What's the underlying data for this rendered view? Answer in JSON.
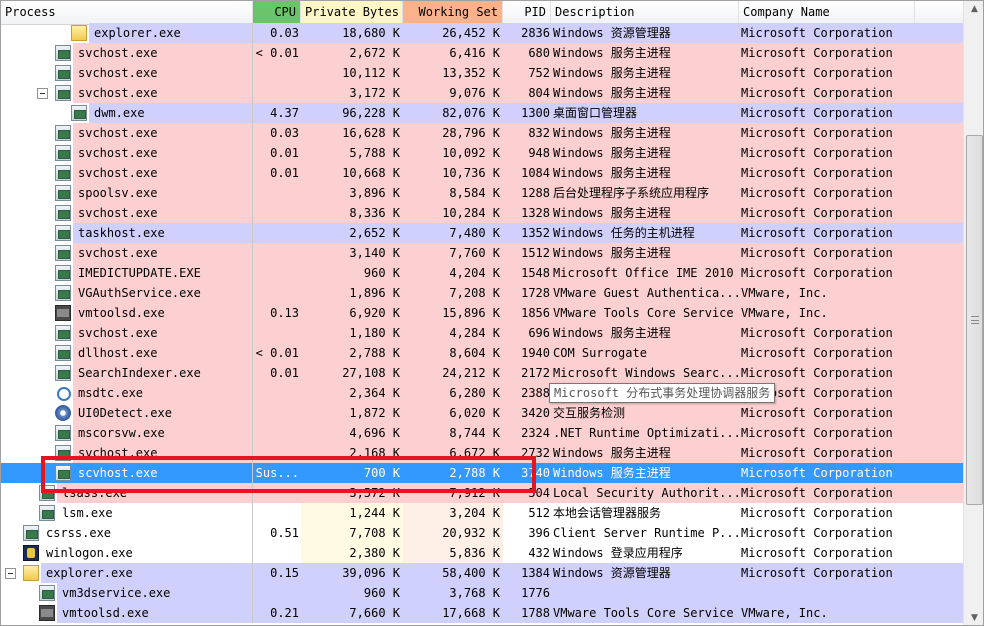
{
  "columns": {
    "process": "Process",
    "cpu": "CPU",
    "private_bytes": "Private Bytes",
    "working_set": "Working Set",
    "pid": "PID",
    "description": "Description",
    "company": "Company Name"
  },
  "colors": {
    "service_row": "#fcd0d0",
    "user_row": "#d0d0fc",
    "selected_row": "#3399ff",
    "cpu_header": "#6ac46a",
    "private_header": "#fdf6c6",
    "working_header": "#fbb189",
    "annotation": "#e8131c"
  },
  "tooltip": "Microsoft 分布式事务处理协调器服务",
  "processes": [
    {
      "name": "explorer.exe",
      "cpu": "0.03",
      "priv": "18,680 K",
      "ws": "26,452 K",
      "pid": "2836",
      "desc": "Windows 资源管理器",
      "comp": "Microsoft Corporation",
      "icon": "folder-icon",
      "kind": "usr",
      "indent": 3
    },
    {
      "name": "svchost.exe",
      "cpu": "< 0.01",
      "priv": "2,672 K",
      "ws": "6,416 K",
      "pid": "680",
      "desc": "Windows 服务主进程",
      "comp": "Microsoft Corporation",
      "icon": "service-icon",
      "kind": "svc",
      "indent": 2
    },
    {
      "name": "svchost.exe",
      "cpu": "",
      "priv": "10,112 K",
      "ws": "13,352 K",
      "pid": "752",
      "desc": "Windows 服务主进程",
      "comp": "Microsoft Corporation",
      "icon": "service-icon",
      "kind": "svc",
      "indent": 2
    },
    {
      "name": "svchost.exe",
      "cpu": "",
      "priv": "3,172 K",
      "ws": "9,076 K",
      "pid": "804",
      "desc": "Windows 服务主进程",
      "comp": "Microsoft Corporation",
      "icon": "service-icon",
      "kind": "svc",
      "indent": 2,
      "twisty": true
    },
    {
      "name": "dwm.exe",
      "cpu": "4.37",
      "priv": "96,228 K",
      "ws": "82,076 K",
      "pid": "1300",
      "desc": "桌面窗口管理器",
      "comp": "Microsoft Corporation",
      "icon": "service-icon",
      "kind": "usr",
      "indent": 3
    },
    {
      "name": "svchost.exe",
      "cpu": "0.03",
      "priv": "16,628 K",
      "ws": "28,796 K",
      "pid": "832",
      "desc": "Windows 服务主进程",
      "comp": "Microsoft Corporation",
      "icon": "service-icon",
      "kind": "svc",
      "indent": 2
    },
    {
      "name": "svchost.exe",
      "cpu": "0.01",
      "priv": "5,788 K",
      "ws": "10,092 K",
      "pid": "948",
      "desc": "Windows 服务主进程",
      "comp": "Microsoft Corporation",
      "icon": "service-icon",
      "kind": "svc",
      "indent": 2
    },
    {
      "name": "svchost.exe",
      "cpu": "0.01",
      "priv": "10,668 K",
      "ws": "10,736 K",
      "pid": "1084",
      "desc": "Windows 服务主进程",
      "comp": "Microsoft Corporation",
      "icon": "service-icon",
      "kind": "svc",
      "indent": 2
    },
    {
      "name": "spoolsv.exe",
      "cpu": "",
      "priv": "3,896 K",
      "ws": "8,584 K",
      "pid": "1288",
      "desc": "后台处理程序子系统应用程序",
      "comp": "Microsoft Corporation",
      "icon": "service-icon",
      "kind": "svc",
      "indent": 2
    },
    {
      "name": "svchost.exe",
      "cpu": "",
      "priv": "8,336 K",
      "ws": "10,284 K",
      "pid": "1328",
      "desc": "Windows 服务主进程",
      "comp": "Microsoft Corporation",
      "icon": "service-icon",
      "kind": "svc",
      "indent": 2
    },
    {
      "name": "taskhost.exe",
      "cpu": "",
      "priv": "2,652 K",
      "ws": "7,480 K",
      "pid": "1352",
      "desc": "Windows 任务的主机进程",
      "comp": "Microsoft Corporation",
      "icon": "service-icon",
      "kind": "usr",
      "indent": 2
    },
    {
      "name": "svchost.exe",
      "cpu": "",
      "priv": "3,140 K",
      "ws": "7,760 K",
      "pid": "1512",
      "desc": "Windows 服务主进程",
      "comp": "Microsoft Corporation",
      "icon": "service-icon",
      "kind": "svc",
      "indent": 2
    },
    {
      "name": "IMEDICTUPDATE.EXE",
      "cpu": "",
      "priv": "960 K",
      "ws": "4,204 K",
      "pid": "1548",
      "desc": "Microsoft Office IME 2010",
      "comp": "Microsoft Corporation",
      "icon": "service-icon",
      "kind": "svc",
      "indent": 2
    },
    {
      "name": "VGAuthService.exe",
      "cpu": "",
      "priv": "1,896 K",
      "ws": "7,208 K",
      "pid": "1728",
      "desc": "VMware Guest Authentica...",
      "comp": "VMware, Inc.",
      "icon": "service-icon",
      "kind": "svc",
      "indent": 2
    },
    {
      "name": "vmtoolsd.exe",
      "cpu": "0.13",
      "priv": "6,920 K",
      "ws": "15,896 K",
      "pid": "1856",
      "desc": "VMware Tools Core Service",
      "comp": "VMware, Inc.",
      "icon": "vmware-icon",
      "kind": "svc",
      "indent": 2
    },
    {
      "name": "svchost.exe",
      "cpu": "",
      "priv": "1,180 K",
      "ws": "4,284 K",
      "pid": "696",
      "desc": "Windows 服务主进程",
      "comp": "Microsoft Corporation",
      "icon": "service-icon",
      "kind": "svc",
      "indent": 2
    },
    {
      "name": "dllhost.exe",
      "cpu": "< 0.01",
      "priv": "2,788 K",
      "ws": "8,604 K",
      "pid": "1940",
      "desc": "COM Surrogate",
      "comp": "Microsoft Corporation",
      "icon": "service-icon",
      "kind": "svc",
      "indent": 2
    },
    {
      "name": "SearchIndexer.exe",
      "cpu": "0.01",
      "priv": "27,108 K",
      "ws": "24,212 K",
      "pid": "2172",
      "desc": "Microsoft Windows Searc...",
      "comp": "Microsoft Corporation",
      "icon": "service-icon",
      "kind": "svc",
      "indent": 2
    },
    {
      "name": "msdtc.exe",
      "cpu": "",
      "priv": "2,364 K",
      "ws": "6,280 K",
      "pid": "2388",
      "desc": "",
      "comp": "Microsoft Corporation",
      "icon": "share-icon",
      "kind": "svc",
      "indent": 2
    },
    {
      "name": "UI0Detect.exe",
      "cpu": "",
      "priv": "1,872 K",
      "ws": "6,020 K",
      "pid": "3420",
      "desc": "交互服务检测",
      "comp": "Microsoft Corporation",
      "icon": "gear-icon",
      "kind": "svc",
      "indent": 2
    },
    {
      "name": "mscorsvw.exe",
      "cpu": "",
      "priv": "4,696 K",
      "ws": "8,744 K",
      "pid": "2324",
      "desc": ".NET Runtime Optimizati...",
      "comp": "Microsoft Corporation",
      "icon": "service-icon",
      "kind": "svc",
      "indent": 2
    },
    {
      "name": "svchost.exe",
      "cpu": "",
      "priv": "2,168 K",
      "ws": "6,672 K",
      "pid": "2732",
      "desc": "Windows 服务主进程",
      "comp": "Microsoft Corporation",
      "icon": "service-icon",
      "kind": "svc",
      "indent": 2
    },
    {
      "name": "scvhost.exe",
      "cpu": "Sus...",
      "priv": "700 K",
      "ws": "2,788 K",
      "pid": "3740",
      "desc": "Windows 服务主进程",
      "comp": "Microsoft Corporation",
      "icon": "service-icon",
      "kind": "sel",
      "indent": 2
    },
    {
      "name": "lsass.exe",
      "cpu": "",
      "priv": "3,572 K",
      "ws": "7,912 K",
      "pid": "504",
      "desc": "Local Security Authorit...",
      "comp": "Microsoft Corporation",
      "icon": "service-icon",
      "kind": "svc",
      "indent": 1
    },
    {
      "name": "lsm.exe",
      "cpu": "",
      "priv": "1,244 K",
      "ws": "3,204 K",
      "pid": "512",
      "desc": "本地会话管理器服务",
      "comp": "Microsoft Corporation",
      "icon": "service-icon",
      "kind": "wht",
      "indent": 1
    },
    {
      "name": "csrss.exe",
      "cpu": "0.51",
      "priv": "7,708 K",
      "ws": "20,932 K",
      "pid": "396",
      "desc": "Client Server Runtime P...",
      "comp": "Microsoft Corporation",
      "icon": "service-icon",
      "kind": "wht",
      "indent": 0
    },
    {
      "name": "winlogon.exe",
      "cpu": "",
      "priv": "2,380 K",
      "ws": "5,836 K",
      "pid": "432",
      "desc": "Windows 登录应用程序",
      "comp": "Microsoft Corporation",
      "icon": "winlogon-icon",
      "kind": "wht",
      "indent": 0
    },
    {
      "name": "explorer.exe",
      "cpu": "0.15",
      "priv": "39,096 K",
      "ws": "58,400 K",
      "pid": "1384",
      "desc": "Windows 资源管理器",
      "comp": "Microsoft Corporation",
      "icon": "folder-icon",
      "kind": "usr",
      "indent": 0,
      "twisty": true
    },
    {
      "name": "vm3dservice.exe",
      "cpu": "",
      "priv": "960 K",
      "ws": "3,768 K",
      "pid": "1776",
      "desc": "",
      "comp": "",
      "icon": "service-icon",
      "kind": "usr",
      "indent": 1
    },
    {
      "name": "vmtoolsd.exe",
      "cpu": "0.21",
      "priv": "7,660 K",
      "ws": "17,668 K",
      "pid": "1788",
      "desc": "VMware Tools Core Service",
      "comp": "VMware, Inc.",
      "icon": "vmware-icon",
      "kind": "usr",
      "indent": 1
    }
  ]
}
